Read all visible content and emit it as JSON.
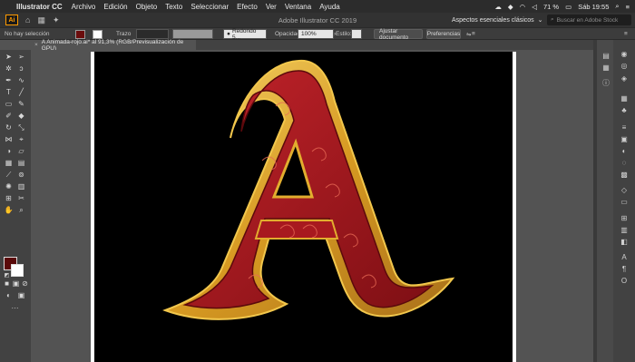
{
  "menubar": {
    "app_name": "Illustrator CC",
    "items": [
      "Archivo",
      "Edición",
      "Objeto",
      "Texto",
      "Seleccionar",
      "Efecto",
      "Ver",
      "Ventana",
      "Ayuda"
    ],
    "battery": "71 %",
    "clock": "Sáb 19:55"
  },
  "appbar": {
    "logo": "Ai",
    "title": "Adobe Illustrator CC 2019",
    "workspace": "Aspectos esenciales clásicos",
    "search_placeholder": "Buscar en Adobe Stock"
  },
  "control_bar": {
    "selection_status": "No hay selección",
    "stroke_label": "Trazo",
    "brush_value": "Redondo 5...",
    "opacity_label": "Opacidad",
    "opacity_value": "100%",
    "style_label": "Estilo:",
    "fit_document_button": "Ajustar documento",
    "preferences_button": "Preferencias"
  },
  "document": {
    "tab_label": "A Animada-rojo.ai* al 91,3% (RGB/Previsualización de GPU)"
  },
  "colors": {
    "fill": "#5a0a0a",
    "stroke": "#ffffff",
    "artboard_bg": "#000000",
    "gold": "#e2ad2e",
    "red": "#a8191f"
  }
}
